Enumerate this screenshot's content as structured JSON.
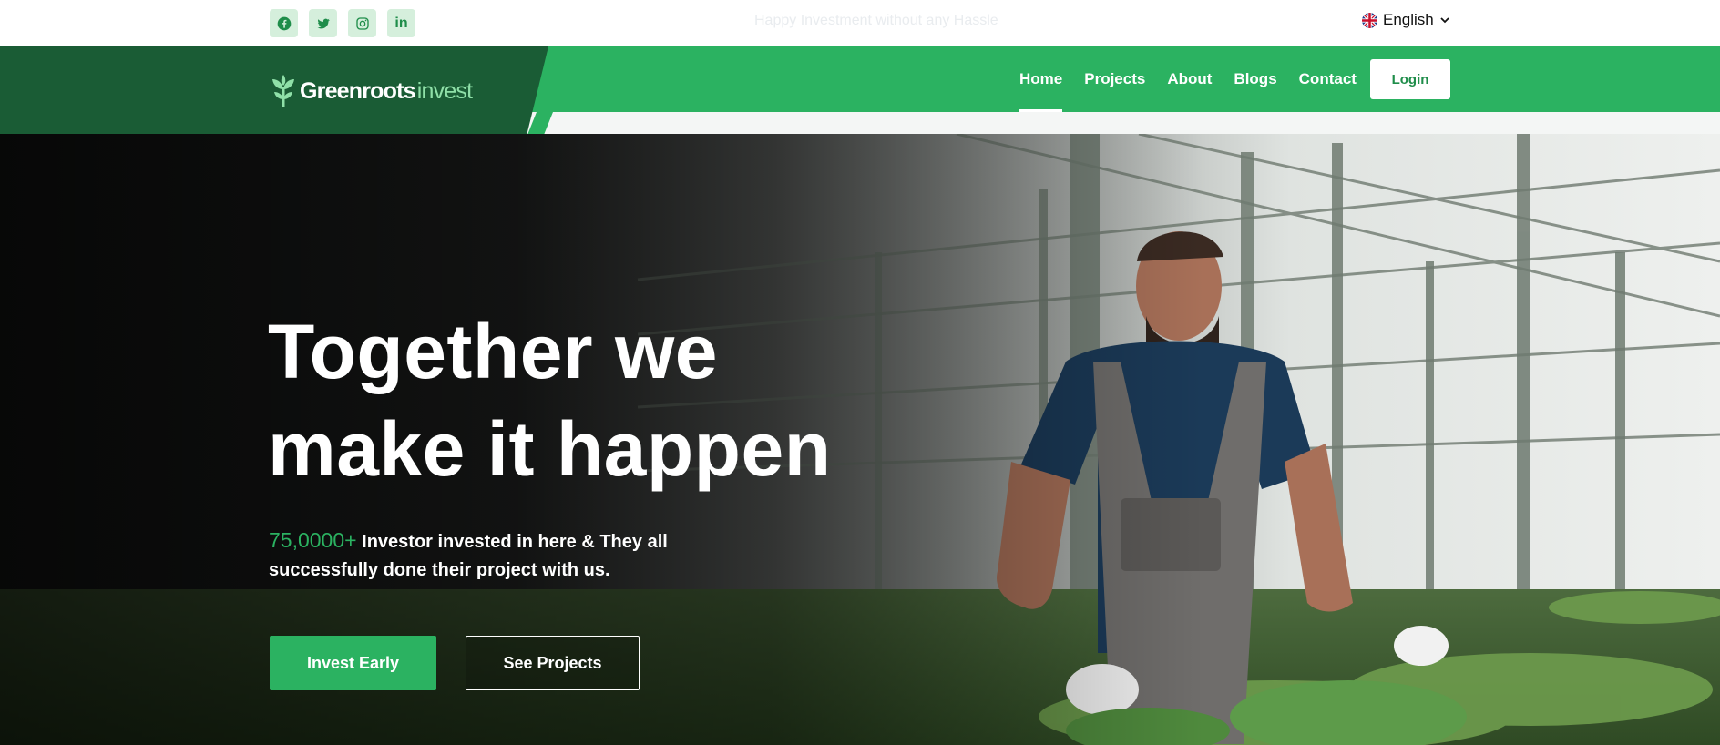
{
  "topbar": {
    "socials": [
      {
        "icon": "facebook-icon"
      },
      {
        "icon": "twitter-icon"
      },
      {
        "icon": "instagram-icon"
      },
      {
        "icon": "linkedin-icon",
        "glyph": "in"
      }
    ],
    "notice": "Happy Investment without any Hassle",
    "language": {
      "label": "English",
      "flag_icon": "uk-flag-icon"
    }
  },
  "brand": {
    "name_bold": "Greenroots",
    "name_light": "invest"
  },
  "nav": {
    "items": [
      {
        "label": "Home",
        "active": true
      },
      {
        "label": "Projects",
        "active": false
      },
      {
        "label": "About",
        "active": false
      },
      {
        "label": "Blogs",
        "active": false
      },
      {
        "label": "Contact",
        "active": false
      }
    ],
    "login_label": "Login"
  },
  "hero": {
    "title_line1": "Together we",
    "title_line2": "make it happen",
    "count": "75,0000+",
    "subtitle": "Investor invested in here & They all successfully done their project with us.",
    "primary_button": "Invest Early",
    "secondary_button": "See Projects"
  },
  "colors": {
    "brand_green": "#2bb261",
    "dark_green": "#1a5c35",
    "social_bg": "#d5efdc",
    "social_icon": "#1f8d4a"
  }
}
